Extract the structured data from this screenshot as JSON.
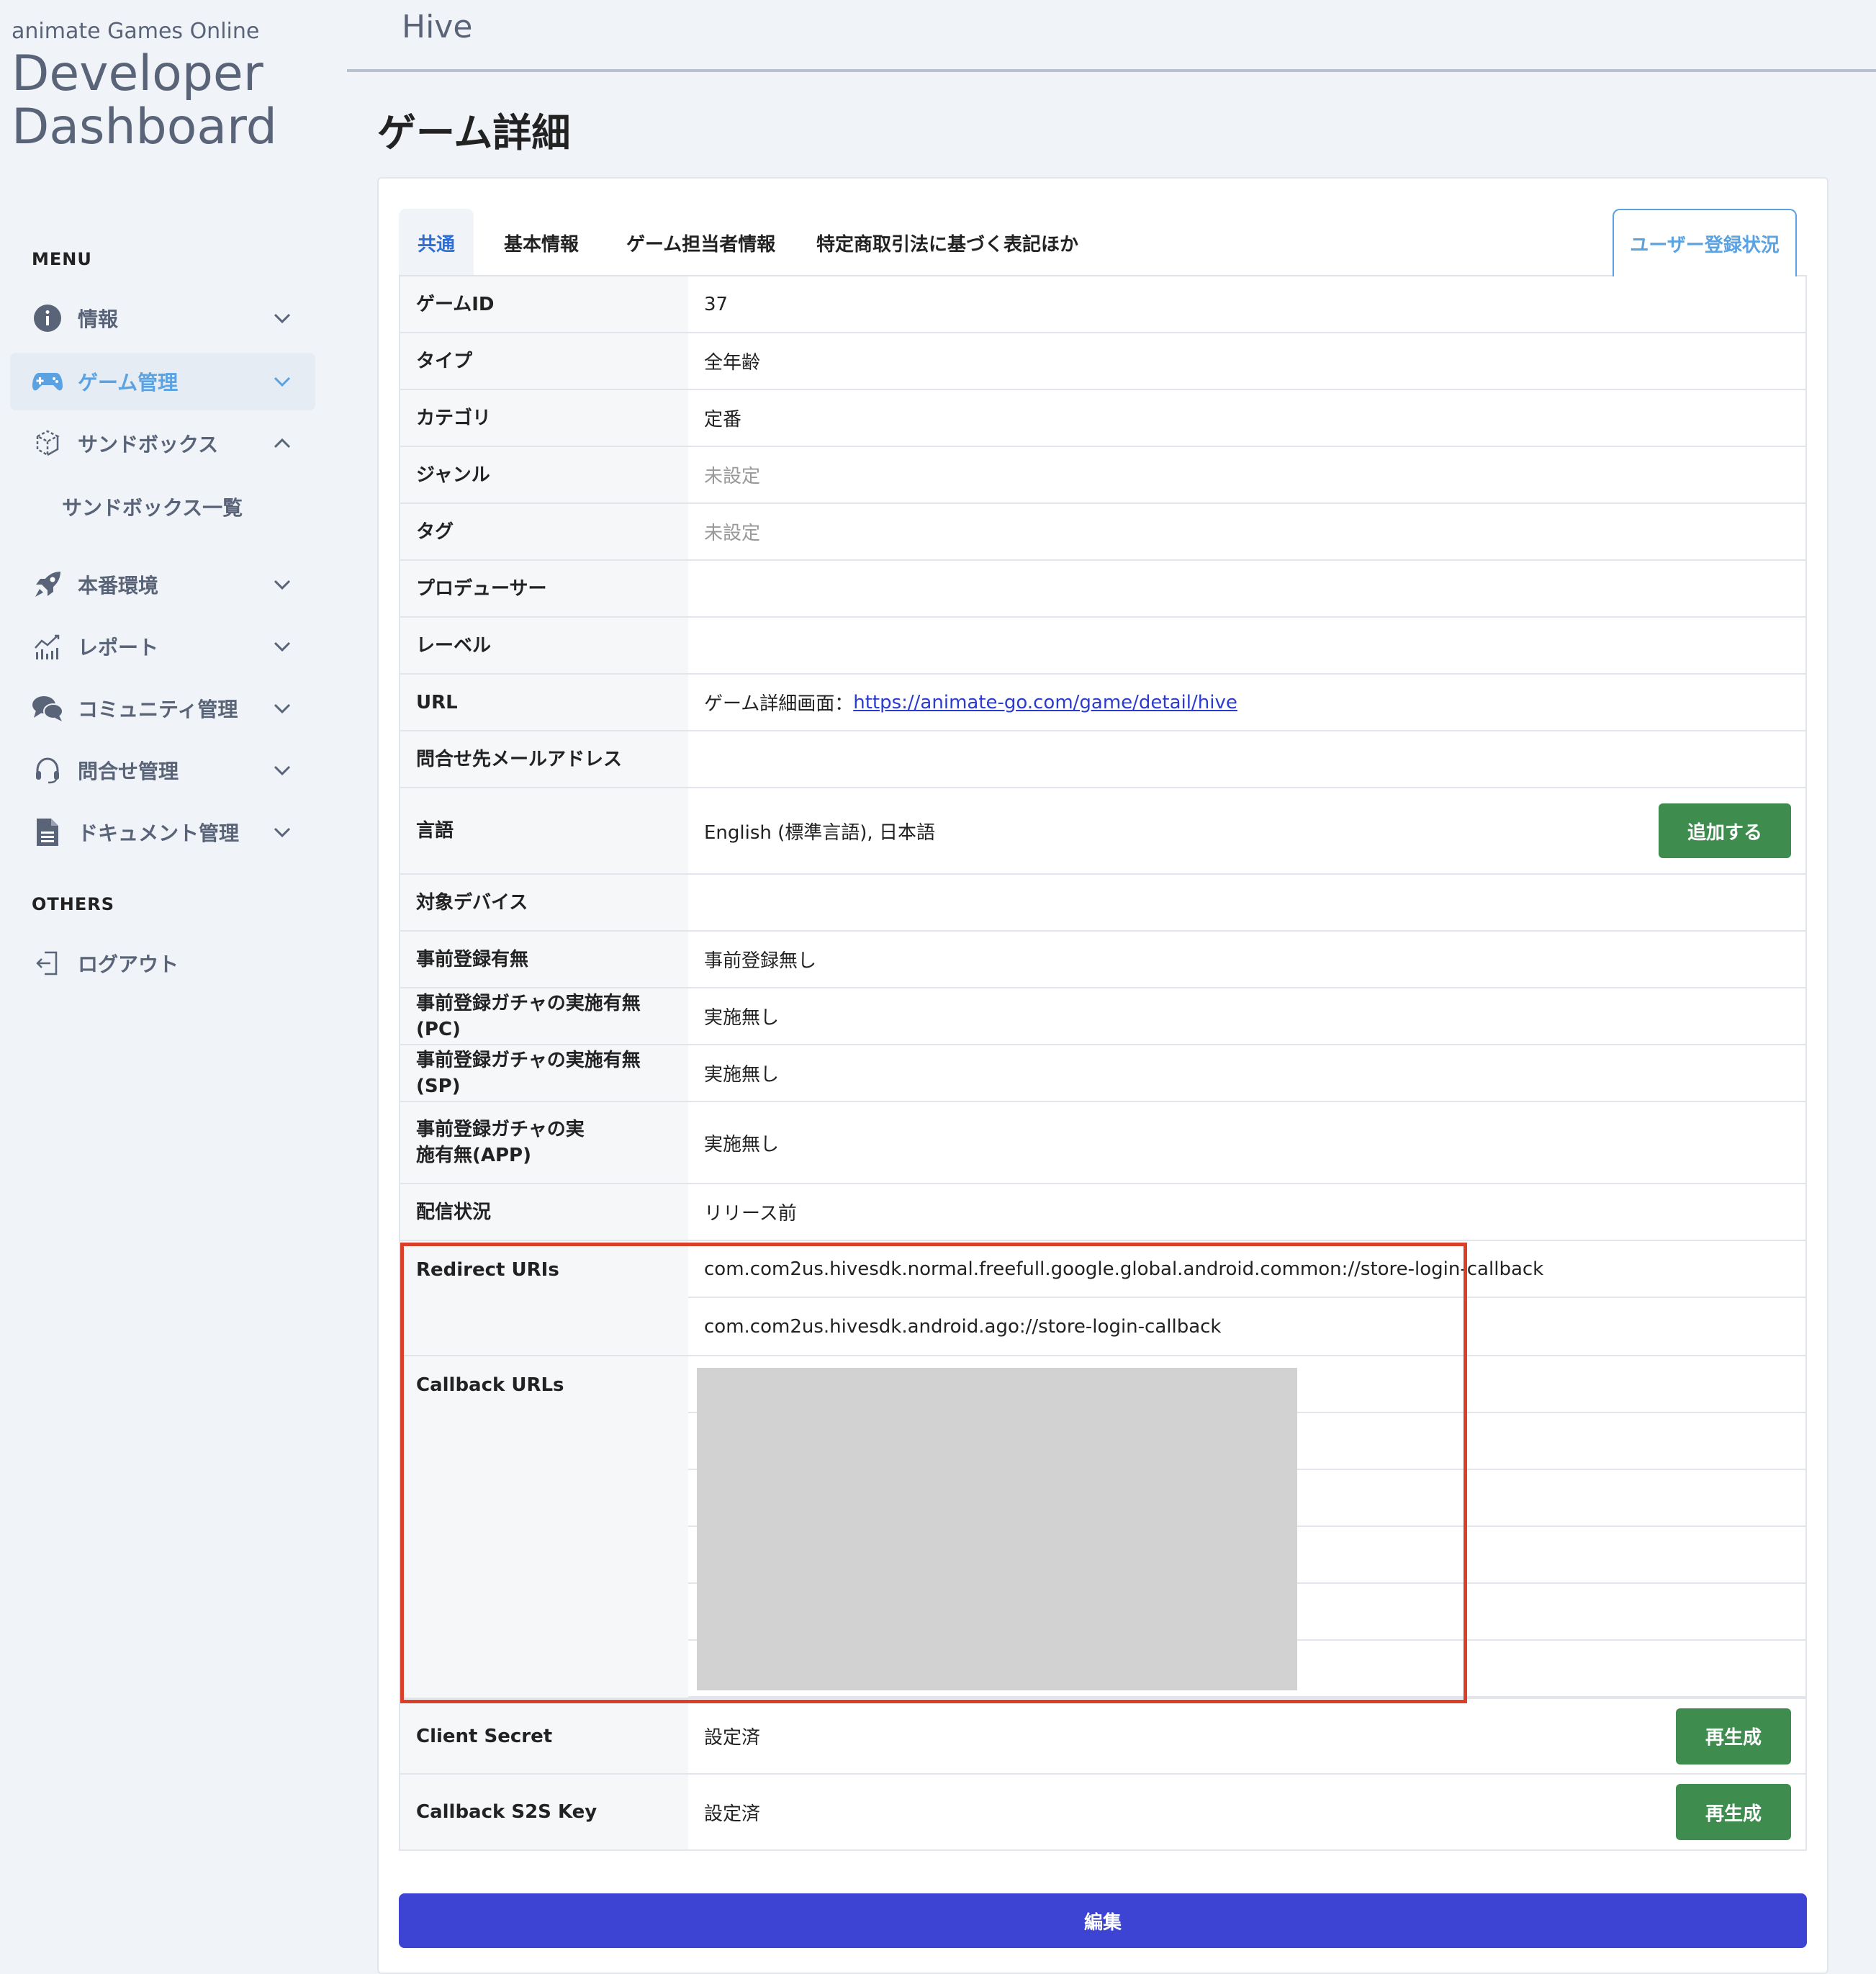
{
  "brand": {
    "top": "animate Games Online",
    "line1": "Developer",
    "line2": "Dashboard"
  },
  "sidebar": {
    "menu_label": "MENU",
    "items": [
      {
        "label": "情報",
        "icon": "info-icon"
      },
      {
        "label": "ゲーム管理",
        "icon": "gamepad-icon",
        "active": true
      },
      {
        "label": "サンドボックス",
        "icon": "sandbox-icon",
        "expanded": true
      },
      {
        "label": "本番環境",
        "icon": "rocket-icon"
      },
      {
        "label": "レポート",
        "icon": "chart-icon"
      },
      {
        "label": "コミュニティ管理",
        "icon": "chat-icon"
      },
      {
        "label": "問合せ管理",
        "icon": "headset-icon"
      },
      {
        "label": "ドキュメント管理",
        "icon": "document-icon"
      }
    ],
    "sub_items": [
      {
        "label": "サンドボックス一覧"
      }
    ],
    "others_label": "OTHERS",
    "logout": {
      "label": "ログアウト",
      "icon": "logout-icon"
    }
  },
  "header": {
    "title": "Hive"
  },
  "page": {
    "title": "ゲーム詳細"
  },
  "tabs": [
    {
      "label": "共通",
      "active": true
    },
    {
      "label": "基本情報"
    },
    {
      "label": "ゲーム担当者情報"
    },
    {
      "label": "特定商取引法に基づく表記ほか"
    }
  ],
  "user_reg_button": "ユーザー登録状況",
  "details": {
    "game_id": {
      "label": "ゲームID",
      "value": "37"
    },
    "type": {
      "label": "タイプ",
      "value": "全年齢"
    },
    "category": {
      "label": "カテゴリ",
      "value": "定番"
    },
    "genre": {
      "label": "ジャンル",
      "value": "未設定"
    },
    "tag": {
      "label": "タグ",
      "value": "未設定"
    },
    "producer": {
      "label": "プロデューサー",
      "value": ""
    },
    "label_row": {
      "label": "レーベル",
      "value": ""
    },
    "url": {
      "label": "URL",
      "prefix": "ゲーム詳細画面：",
      "link": "https://animate-go.com/game/detail/hive"
    },
    "contact_email": {
      "label": "問合せ先メールアドレス",
      "value": ""
    },
    "language": {
      "label": "言語",
      "value": "English (標準言語), 日本語",
      "button": "追加する"
    },
    "target_device": {
      "label": "対象デバイス",
      "value": ""
    },
    "pre_reg": {
      "label": "事前登録有無",
      "value": "事前登録無し"
    },
    "gacha_pc": {
      "label": "事前登録ガチャの実施有無(PC)",
      "value": "実施無し"
    },
    "gacha_sp": {
      "label": "事前登録ガチャの実施有無(SP)",
      "value": "実施無し"
    },
    "gacha_app": {
      "label": "事前登録ガチャの実施有無(APP)",
      "value": "実施無し"
    },
    "delivery": {
      "label": "配信状況",
      "value": "リリース前"
    },
    "redirect_uris": {
      "label": "Redirect URIs",
      "values": [
        "com.com2us.hivesdk.normal.freefull.google.global.android.common://store-login-callback",
        "com.com2us.hivesdk.android.ago://store-login-callback"
      ]
    },
    "callback_urls": {
      "label": "Callback URLs"
    },
    "client_secret": {
      "label": "Client Secret",
      "value": "設定済",
      "button": "再生成"
    },
    "callback_s2s": {
      "label": "Callback S2S Key",
      "value": "設定済",
      "button": "再生成"
    }
  },
  "edit_button": "編集"
}
